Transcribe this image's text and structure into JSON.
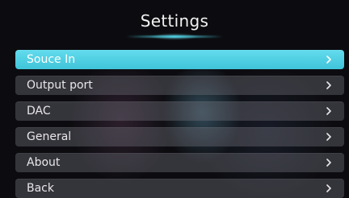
{
  "header": {
    "title": "Settings"
  },
  "menu": {
    "items": [
      {
        "label": "Souce In",
        "active": true
      },
      {
        "label": "Output port",
        "active": false
      },
      {
        "label": "DAC",
        "active": false
      },
      {
        "label": "General",
        "active": false
      },
      {
        "label": "About",
        "active": false
      },
      {
        "label": "Back",
        "active": false
      }
    ]
  },
  "icons": {
    "chevron": "chevron-right-icon"
  },
  "colors": {
    "accent": "#4fd1e3",
    "item_bg": "#4a4a50",
    "background": "#0c0c10"
  }
}
